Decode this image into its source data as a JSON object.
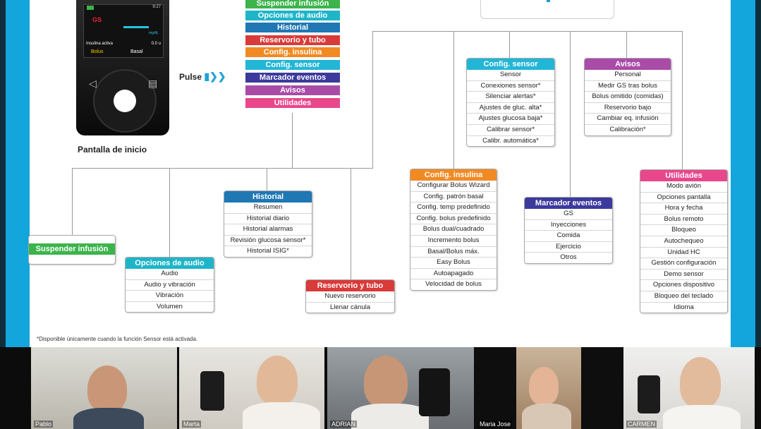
{
  "main_menu": [
    "Suspender infusión",
    "Opciones de audio",
    "Historial",
    "Reservorio y tubo",
    "Config. insulina",
    "Config. sensor",
    "Marcador eventos",
    "Avisos",
    "Utilidades"
  ],
  "pump": {
    "title": "Pantalla de inicio",
    "pulse": "Pulse",
    "gs_label": "GS",
    "units": "mg/dL",
    "insulin_label": "Insulina activa",
    "insulin_value": "0.0 u",
    "bolus": "Bolus",
    "basal": "Basal",
    "time": "9:27"
  },
  "boxes": {
    "suspender": {
      "title": "Suspender infusión",
      "items": []
    },
    "audio": {
      "title": "Opciones de audio",
      "items": [
        "Audio",
        "Audio y vibración",
        "Vibración",
        "Volumen"
      ]
    },
    "historial": {
      "title": "Historial",
      "items": [
        "Resumen",
        "Historial diario",
        "Historial alarmas",
        "Revisión glucosa sensor*",
        "Historial ISIG*"
      ]
    },
    "reservorio": {
      "title": "Reservorio y tubo",
      "items": [
        "Nuevo reservorio",
        "Llenar cánula"
      ]
    },
    "insulina": {
      "title": "Config. insulina",
      "items": [
        "Configurar Bolus Wizard",
        "Config. patrón basal",
        "Config. temp predefinido",
        "Config. bolus predefinido",
        "Bolus dual/cuadrado",
        "Incremento bolus",
        "Basal/Bolus máx.",
        "Easy Bolus",
        "Autoapagado",
        "Velocidad de bolus"
      ]
    },
    "sensor": {
      "title": "Config. sensor",
      "items": [
        "Sensor",
        "Conexiones sensor*",
        "Silenciar alertas*",
        "Ajustes de gluc. alta*",
        "Ajustes glucosa baja*",
        "Calibrar sensor*",
        "Calibr. automática*"
      ]
    },
    "marcador": {
      "title": "Marcador eventos",
      "items": [
        "GS",
        "Inyecciones",
        "Comida",
        "Ejercicio",
        "Otros"
      ]
    },
    "avisos": {
      "title": "Avisos",
      "items": [
        "Personal",
        "Medir GS tras bolus",
        "Bolus omitido (comidas)",
        "Reservorio bajo",
        "Cambiar eq. infusión",
        "Calibración*"
      ]
    },
    "utilidades": {
      "title": "Utilidades",
      "items": [
        "Modo avión",
        "Opciones pantalla",
        "Hora y fecha",
        "Bolus remoto",
        "Bloqueo",
        "Autochequeo",
        "Unidad HC",
        "Gestión configuración",
        "Demo sensor",
        "Opciones dispositivo",
        "Bloqueo del teclado",
        "Idioma"
      ]
    }
  },
  "footnote": "*Disponible únicamente cuando la función Sensor está activada.",
  "participants": [
    "Pablo",
    "Marta",
    "ADRIAN",
    "Maria Jose",
    "CARMEN"
  ],
  "colors": {
    "green": "#3cb44b",
    "teal": "#1eb5c9",
    "blue": "#1f77b4",
    "red": "#d93a3a",
    "orange": "#f28a23",
    "cyan": "#22b6d6",
    "purple": "#3c3a9c",
    "magenta": "#a94ca8",
    "pink": "#e8478b"
  }
}
